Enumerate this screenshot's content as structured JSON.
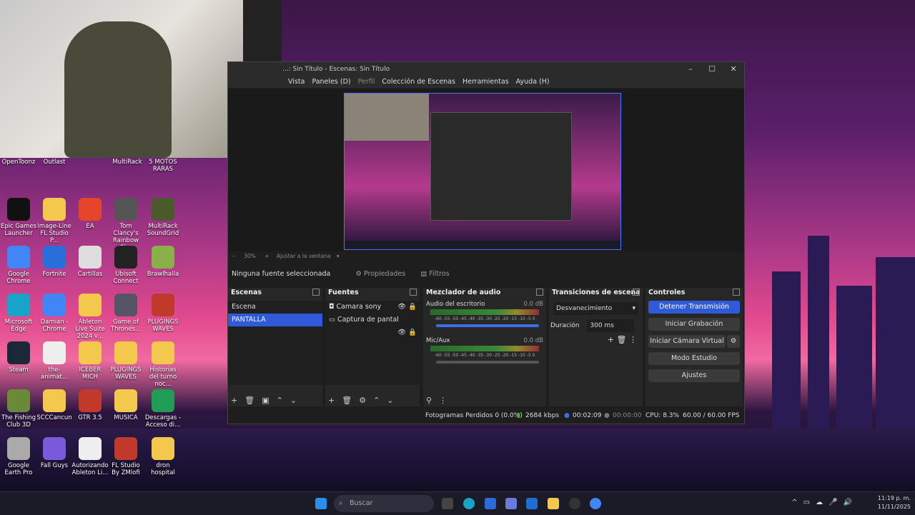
{
  "desktop": {
    "icons": [
      {
        "label": "OpenToonz",
        "color": "#4fa74f"
      },
      {
        "label": "Outlast",
        "color": "#222"
      },
      {
        "label": "MultiRack",
        "color": "#7a9a4a"
      },
      {
        "label": "5 MOTOS RARAS",
        "color": "#f2c94c"
      },
      {
        "label": "Epic Games Launcher",
        "color": "#111"
      },
      {
        "label": "Image-Line FL Studio P...",
        "color": "#f2c94c"
      },
      {
        "label": "EA",
        "color": "#e6452b"
      },
      {
        "label": "Tom Clancy's Rainbow Si...",
        "color": "#555"
      },
      {
        "label": "MultiRack SoundGrid",
        "color": "#4a5a2a"
      },
      {
        "label": "Google Chrome",
        "color": "#4285f4"
      },
      {
        "label": "Fortnite",
        "color": "#2a6fd9"
      },
      {
        "label": "Cartillas",
        "color": "#ddd"
      },
      {
        "label": "Ubisoft Connect",
        "color": "#222"
      },
      {
        "label": "Brawlhalla",
        "color": "#8ab04a"
      },
      {
        "label": "Microsoft Edge",
        "color": "#1aa3c9"
      },
      {
        "label": "Damian - Chrome",
        "color": "#4285f4"
      },
      {
        "label": "Ableton Live Suite 2024 v...",
        "color": "#f2c94c"
      },
      {
        "label": "Game of Thrones...",
        "color": "#556"
      },
      {
        "label": "PLUGINGS WAVES",
        "color": "#c0392b"
      },
      {
        "label": "Steam",
        "color": "#1b2838"
      },
      {
        "label": "the-animat...",
        "color": "#eee"
      },
      {
        "label": "ICEBER MICH",
        "color": "#f2c94c"
      },
      {
        "label": "PLUGINGS WAVES",
        "color": "#f2c94c"
      },
      {
        "label": "Historias del turno noc...",
        "color": "#f2c94c"
      },
      {
        "label": "The Fishing Club 3D",
        "color": "#6a8a3a"
      },
      {
        "label": "SCCCancun",
        "color": "#f2c94c"
      },
      {
        "label": "GTR 3.5",
        "color": "#c0392b"
      },
      {
        "label": "MUSICA",
        "color": "#f2c94c"
      },
      {
        "label": "Descargas - Acceso di...",
        "color": "#1f9d55"
      },
      {
        "label": "Google Earth Pro",
        "color": "#aaa"
      },
      {
        "label": "Fall Guys",
        "color": "#7a5ad9"
      },
      {
        "label": "Autorizando Ableton Li...",
        "color": "#eee"
      },
      {
        "label": "FL Studio By ZMlofi",
        "color": "#c0392b"
      },
      {
        "label": "dron hospital",
        "color": "#f2c94c"
      }
    ]
  },
  "obs": {
    "title": "...: Sin Título - Escenas: Sin Título",
    "menu": [
      "Vista",
      "Paneles (D)",
      "Perfil",
      "Colección de Escenas",
      "Herramientas",
      "Ayuda (H)"
    ],
    "zoom": {
      "minus": "–",
      "value": "30%",
      "plus": "+",
      "fit": "Ajustar a la ventana"
    },
    "source_bar": {
      "no_source": "Ninguna fuente seleccionada",
      "properties": "Propiedades",
      "filters": "Filtros"
    },
    "scenes": {
      "title": "Escenas",
      "items": [
        "Escena",
        "PANTALLA"
      ]
    },
    "sources": {
      "title": "Fuentes",
      "items": [
        "Camara sony",
        "Captura de pantal"
      ]
    },
    "mixer": {
      "title": "Mezclador de audio",
      "channels": [
        {
          "name": "Audio del escritorio",
          "db": "0.0 dB"
        },
        {
          "name": "Mic/Aux",
          "db": "0.0 dB"
        }
      ],
      "scale": "-60 -55 -50 -45 -40 -35 -30 -25 -20 -15 -10 -5 0"
    },
    "transitions": {
      "title": "Transiciones de escena",
      "selected": "Desvanecimiento",
      "duration_label": "Duración",
      "duration": "300 ms"
    },
    "controls": {
      "title": "Controles",
      "buttons": [
        "Detener Transmisión",
        "Iniciar Grabación",
        "Iniciar Cámara Virtual",
        "Modo Estudio",
        "Ajustes"
      ]
    },
    "status": {
      "dropped": "Fotogramas Perdidos 0 (0.0%)",
      "bitrate": "2684 kbps",
      "stream_time": "00:02:09",
      "rec_time": "00:00:00",
      "cpu": "CPU: 8.3%",
      "fps": "60.00 / 60.00 FPS"
    }
  },
  "taskbar": {
    "search_placeholder": "Buscar",
    "time": "11:19 p. m.",
    "date": "11/11/2025"
  }
}
